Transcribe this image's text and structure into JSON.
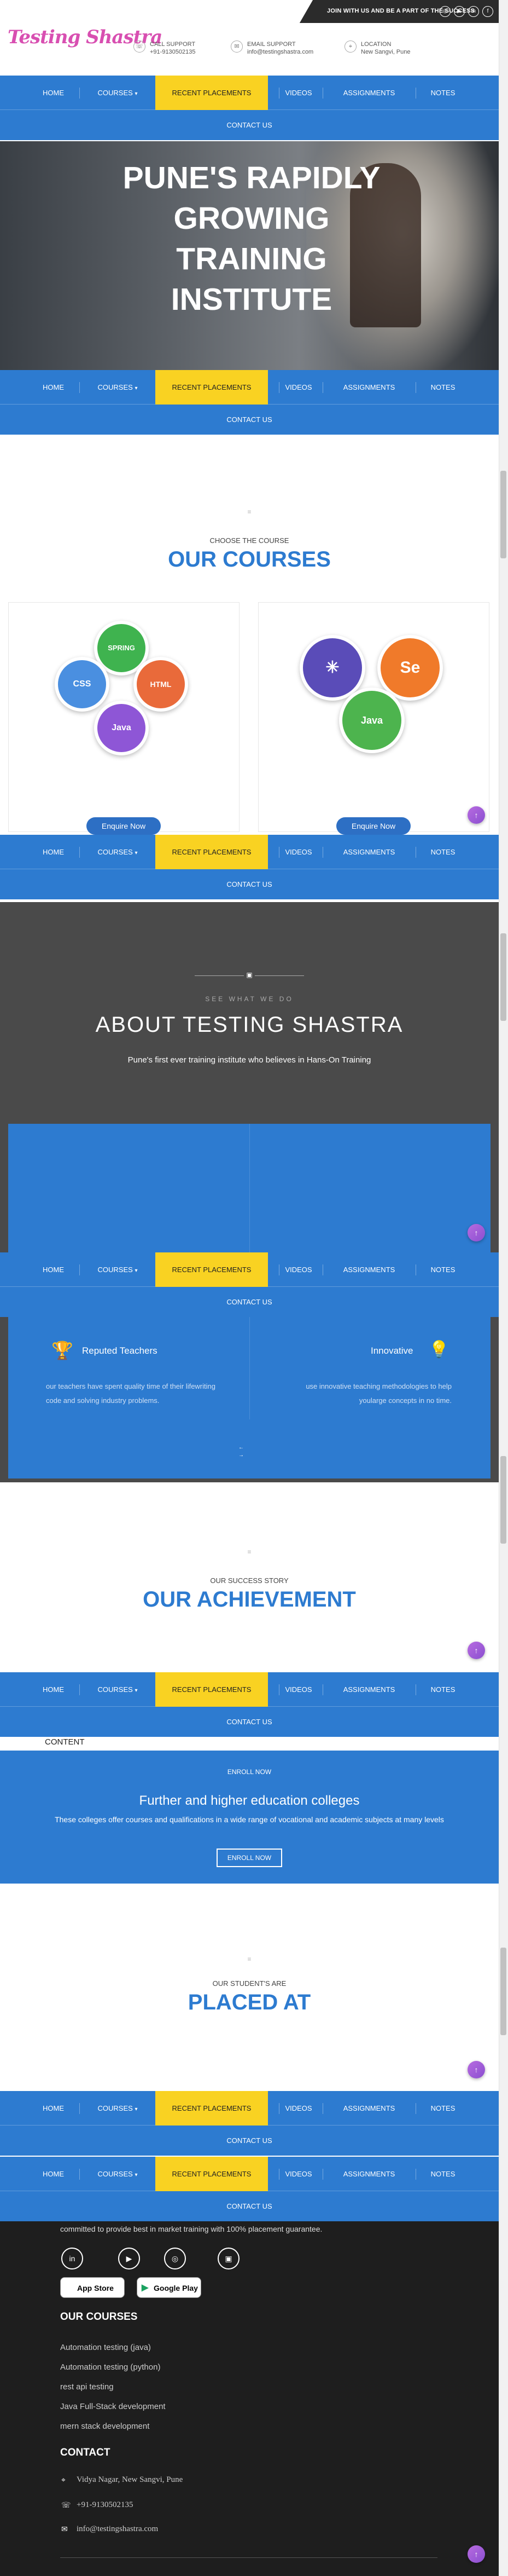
{
  "topbar": {
    "tagline": "JOIN WITH US AND BE A PART OF THE SUCCESS",
    "socials": [
      "instagram-icon",
      "youtube-icon",
      "linkedin-icon",
      "facebook-icon"
    ]
  },
  "logo": {
    "part1": "Testing",
    "part2": "Shastra"
  },
  "header_info": [
    {
      "icon": "phone-icon",
      "title": "CALL SUPPORT",
      "value": "+91-9130502135"
    },
    {
      "icon": "mail-icon",
      "title": "EMAIL SUPPORT",
      "value": "info@testingshastra.com"
    },
    {
      "icon": "location-icon",
      "title": "LOCATION",
      "value": "New Sangvi, Pune"
    }
  ],
  "nav": {
    "items": [
      "HOME",
      "COURSES",
      "RECENT PLACEMENTS",
      "VIDEOS",
      "ASSIGNMENTS",
      "NOTES"
    ],
    "courses_caret": "▾",
    "contact": "CONTACT US"
  },
  "hero": {
    "title": "PUNE'S RAPIDLY GROWING TRAINING INSTITUTE"
  },
  "courses": {
    "kicker": "CHOOSE THE COURSE",
    "title": "OUR COURSES",
    "card1": [
      "SPRING",
      "CSS",
      "HTML",
      "Java"
    ],
    "card2": [
      "Se",
      "Java"
    ],
    "enquire": "Enquire Now"
  },
  "about": {
    "kicker": "SEE WHAT WE DO",
    "title": "ABOUT TESTING SHASTRA",
    "subtitle": "Pune's first ever training institute who believes in Hans-On Training",
    "features": [
      {
        "title": "Reputed Teachers",
        "text": "our teachers have spent quality time of their lifewriting code and solving industry problems."
      },
      {
        "title": "Innovative",
        "text": "use innovative teaching methodologies to help yoularge concepts in no time."
      }
    ]
  },
  "achievement": {
    "kicker": "OUR SUCCESS STORY",
    "title": "OUR ACHIEVEMENT"
  },
  "content_label": "CONTENT",
  "enroll": {
    "kicker": "ENROLL NOW",
    "title": "Further and higher education colleges",
    "text": "These colleges offer courses and qualifications in a wide range of vocational and academic subjects at many levels",
    "button": "ENROLL NOW"
  },
  "placed": {
    "kicker": "OUR STUDENT'S ARE",
    "title": "PLACED AT"
  },
  "footer": {
    "intro": "committed to provide best in market training with 100% placement guarantee.",
    "socials": [
      "linkedin-icon",
      "youtube-icon",
      "instagram-icon",
      "video-icon"
    ],
    "stores": [
      "App Store",
      "Google Play"
    ],
    "courses_head": "OUR COURSES",
    "courses": [
      "Automation testing (java)",
      "Automation testing (python)",
      "rest api testing",
      "Java Full-Stack development",
      "mern stack development"
    ],
    "contact_head": "CONTACT",
    "address": "Vidya Nagar, New Sangvi, Pune",
    "phone": "+91-9130502135",
    "email": "info@testingshastra.com"
  },
  "colors": {
    "primary": "#2d7bd0",
    "accent": "#f9d222",
    "dark": "#1e1e1e"
  }
}
